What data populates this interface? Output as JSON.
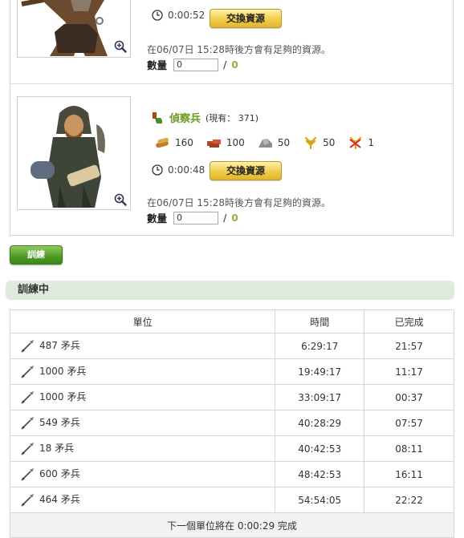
{
  "upper_unit": {
    "timer": "0:00:52",
    "exchange_label": "交換資源",
    "note": "在06/07日 15:28時後方會有足夠的資源。",
    "qty_label": "數量",
    "qty_value": "0",
    "qty_sep": "/",
    "qty_max": "0"
  },
  "scout": {
    "name": "偵察兵",
    "existing": "(現有： 371)",
    "resources": [
      "160",
      "100",
      "50",
      "50",
      "1"
    ],
    "resource_icons": [
      "wood-icon",
      "clay-icon",
      "iron-icon",
      "crop-icon",
      "crop-consumption-icon"
    ],
    "timer": "0:00:48",
    "exchange_label": "交換資源",
    "note": "在06/07日 15:28時後方會有足夠的資源。",
    "qty_label": "數量",
    "qty_value": "0",
    "qty_sep": "/",
    "qty_max": "0"
  },
  "train_button": "訓練",
  "training": {
    "title": "訓練中",
    "headers": [
      "單位",
      "時間",
      "已完成"
    ],
    "rows": [
      {
        "unit": "487 矛兵",
        "time": "6:29:17",
        "done": "21:57"
      },
      {
        "unit": "1000 矛兵",
        "time": "19:49:17",
        "done": "11:17"
      },
      {
        "unit": "1000 矛兵",
        "time": "33:09:17",
        "done": "00:37"
      },
      {
        "unit": "549 矛兵",
        "time": "40:28:29",
        "done": "07:57"
      },
      {
        "unit": "18 矛兵",
        "time": "40:42:53",
        "done": "08:11"
      },
      {
        "unit": "600 矛兵",
        "time": "48:42:53",
        "done": "16:11"
      },
      {
        "unit": "464 矛兵",
        "time": "54:54:05",
        "done": "22:22"
      }
    ],
    "footer": "下一個單位將在 0:00:29 完成"
  }
}
